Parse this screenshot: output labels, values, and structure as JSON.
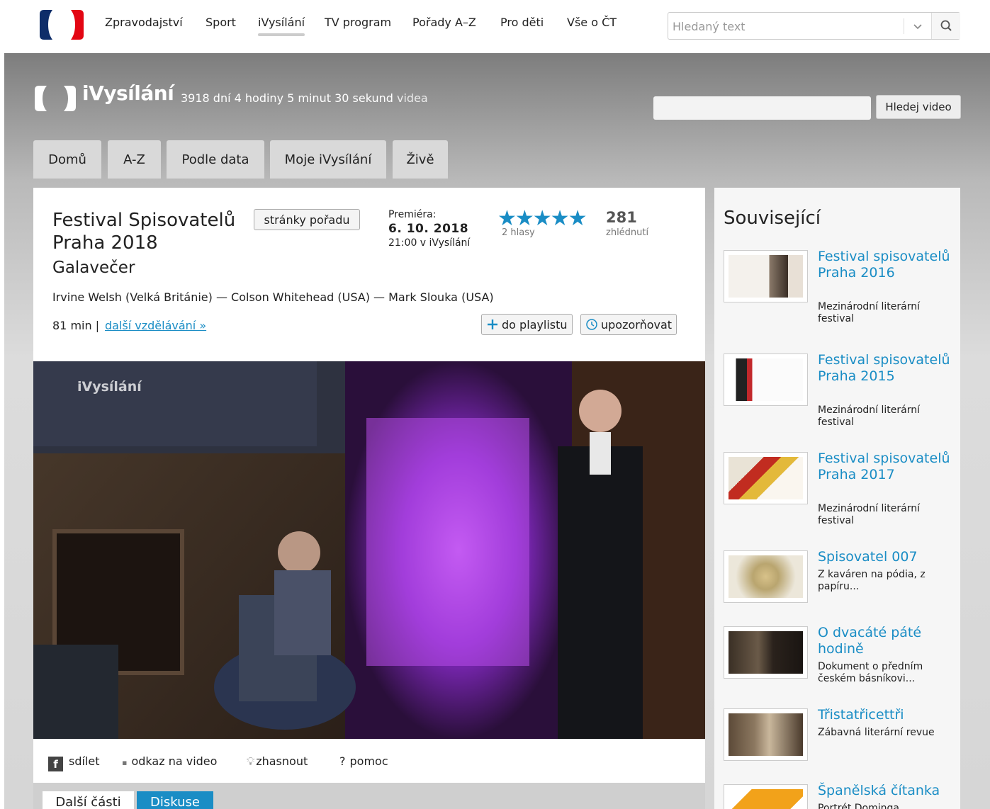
{
  "top_nav": {
    "items": [
      "Zpravodajství",
      "Sport",
      "iVysílání",
      "TV program",
      "Pořady A–Z",
      "Pro děti",
      "Vše o ČT"
    ],
    "active_index": 2,
    "search_placeholder": "Hledaný text"
  },
  "header": {
    "title": "iVysílání",
    "stats": "3918 dní 4 hodiny 5 minut 30 sekund",
    "stats_suffix": "videa",
    "search_button": "Hledej video"
  },
  "tabs": [
    "Domů",
    "A-Z",
    "Podle data",
    "Moje iVysílání",
    "Živě"
  ],
  "show": {
    "title": "Festival Spisovatelů Praha 2018",
    "page_button": "stránky pořadu",
    "episode": "Galavečer",
    "guests": "Irvine Welsh (Velká Británie) — Colson Whitehead (USA) — Mark Slouka (USA)",
    "duration": "81 min |",
    "more_link": "další vzdělávání »",
    "premiere_label": "Premiéra:",
    "premiere_date": "6. 10. 2018",
    "premiere_time": "21:00 v iVysílání",
    "rating": 5,
    "stars": "★★★★★",
    "votes": "2 hlasy",
    "views": "281",
    "views_label": "zhlédnutí",
    "playlist_button": "do playlistu",
    "notify_button": "upozorňovat",
    "video_watermark": "iVysílání"
  },
  "share_bar": {
    "share": "sdílet",
    "link": "odkaz na video",
    "dim": "zhasnout",
    "help": "pomoc"
  },
  "sub_tabs": [
    "Další části",
    "Diskuse"
  ],
  "sidebar": {
    "title": "Související",
    "items": [
      {
        "title": "Festival spisovatelů Praha 2016",
        "desc": "Mezinárodní literární festival"
      },
      {
        "title": "Festival spisovatelů Praha 2015",
        "desc": "Mezinárodní literární festival"
      },
      {
        "title": "Festival spisovatelů Praha 2017",
        "desc": "Mezinárodní literární festival"
      },
      {
        "title": "Spisovatel 007",
        "desc": "Z kaváren na pódia, z papíru..."
      },
      {
        "title": "O dvacáté páté hodině",
        "desc": "Dokument o předním českém básníkovi..."
      },
      {
        "title": "Třistatřicettři",
        "desc": "Zábavná literární revue"
      },
      {
        "title": "Španělská čítanka",
        "desc": "Portrét Dominga..."
      }
    ]
  },
  "colors": {
    "link_blue": "#1a8dc5",
    "ct_red": "#e30613",
    "ct_navy": "#0e2d69",
    "tab_active_blue": "#1a8dc5"
  }
}
